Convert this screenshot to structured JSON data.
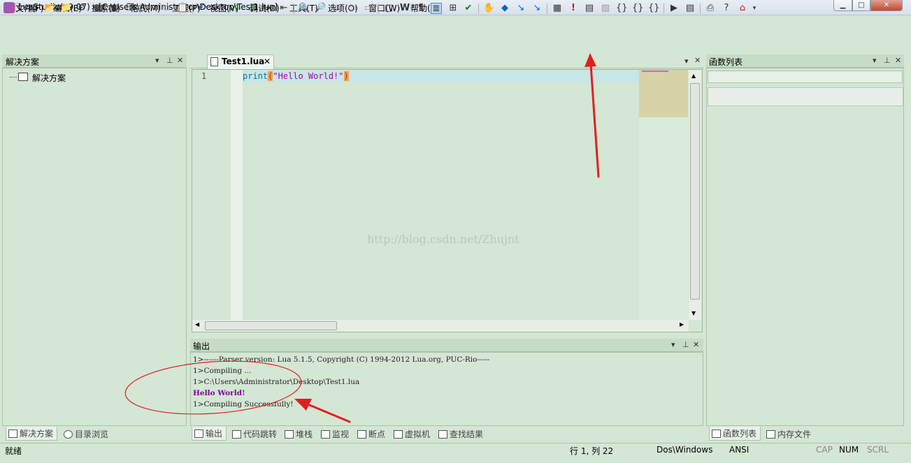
{
  "window": {
    "title": "LuaStudio(v9.07) - [C:\\Users\\Administrator\\Desktop\\Test1.lua]",
    "min": "▁",
    "max": "□",
    "close": "✕"
  },
  "menu": {
    "items": [
      "文件(F)",
      "编辑(E)",
      "搜索(S)",
      "格式(M)",
      "工程(P)",
      "视图(V)",
      "调试(D)",
      "工具(T)",
      "选项(O)",
      "窗口(W)",
      "帮助(H)"
    ]
  },
  "solution_panel": {
    "title": "解决方案",
    "tree_root": "解决方案",
    "tabs": [
      "解决方案",
      "目录浏览"
    ]
  },
  "editor": {
    "tab_label": "Test1.lua",
    "line_number": "1",
    "code_keyword": "print",
    "code_open": "(",
    "code_string": "\"Hello World!\"",
    "code_close": ")",
    "watermark": "http://blog.csdn.net/Zhujnt"
  },
  "output_panel": {
    "title": "输出",
    "lines": [
      "1>------Parser version: Lua 5.1.5, Copyright (C) 1994-2012 Lua.org, PUC-Rio-----",
      "1>Compiling ...",
      "1>C:\\Users\\Administrator\\Desktop\\Test1.lua",
      "Hello World!",
      "1>Compiling Successfully!"
    ],
    "tabs": [
      "输出",
      "代码跳转",
      "堆栈",
      "监视",
      "断点",
      "虚拟机",
      "查找结果"
    ]
  },
  "function_panel": {
    "title": "函数列表",
    "tabs": [
      "函数列表",
      "内存文件"
    ]
  },
  "statusbar": {
    "ready": "就绪",
    "position": "行 1, 列 22",
    "line_ending": "Dos\\Windows",
    "encoding": "ANSI",
    "cap": "CAP",
    "num": "NUM",
    "scrl": "SCRL"
  },
  "colors": {
    "background": "#d4e6d4",
    "keyword": "#0070b0",
    "string": "#b000b0",
    "annotation": "#e02020"
  },
  "toolbar_icons": [
    "new-file-icon",
    "open-project-icon",
    "open-folder-icon",
    "open-file-icon",
    "compile-icon",
    "save-icon",
    "save-all-icon",
    "save-copy-icon",
    "cut-icon",
    "copy-icon",
    "paste-icon",
    "undo-icon",
    "redo-icon",
    "comment-icon",
    "uncomment-icon",
    "indent-icon",
    "outdent-icon",
    "find-icon",
    "find-next-icon",
    "find-in-files-icon",
    "bookmark-icon",
    "bookmark-next-icon",
    "whitespace-icon",
    "word-wrap-icon",
    "paragraph-icon",
    "outline-icon",
    "tree-icon",
    "check-icon",
    "hand-icon",
    "breakpoint-icon",
    "step-icon",
    "step-run-icon",
    "calculator-icon",
    "exclamation-icon",
    "build-icon",
    "clean-icon",
    "step-into-icon",
    "step-over-icon",
    "step-out-icon",
    "run-icon",
    "debug-output-icon",
    "print-icon",
    "help-icon",
    "home-icon"
  ]
}
